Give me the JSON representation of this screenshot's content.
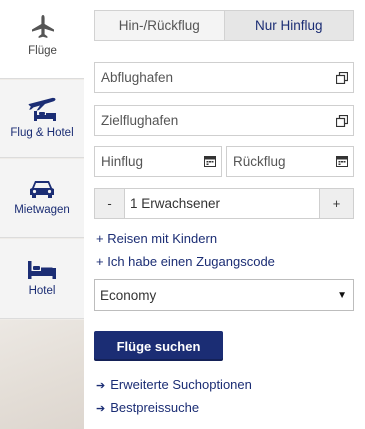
{
  "nav": {
    "items": [
      {
        "label": "Flüge",
        "icon": "airplane-icon"
      },
      {
        "label": "Flug & Hotel",
        "icon": "plane-bed-icon"
      },
      {
        "label": "Mietwagen",
        "icon": "car-icon"
      },
      {
        "label": "Hotel",
        "icon": "bed-icon"
      }
    ]
  },
  "trip_type": {
    "options": [
      "Hin-/Rückflug",
      "Nur Hinflug"
    ],
    "selected": "Nur Hinflug"
  },
  "fields": {
    "origin_placeholder": "Abflughafen",
    "destination_placeholder": "Zielflughafen",
    "departure_placeholder": "Hinflug",
    "return_placeholder": "Rückflug"
  },
  "passengers": {
    "minus": "-",
    "value": "1 Erwachsener",
    "plus": "+"
  },
  "links": {
    "kids": "Reisen mit Kindern",
    "access_code": "Ich habe einen Zugangscode",
    "advanced": "Erweiterte Suchoptionen",
    "best_price": "Bestpreissuche"
  },
  "cabin": {
    "value": "Economy"
  },
  "search_button": "Flüge suchen",
  "colors": {
    "brand": "#1b2d74"
  }
}
